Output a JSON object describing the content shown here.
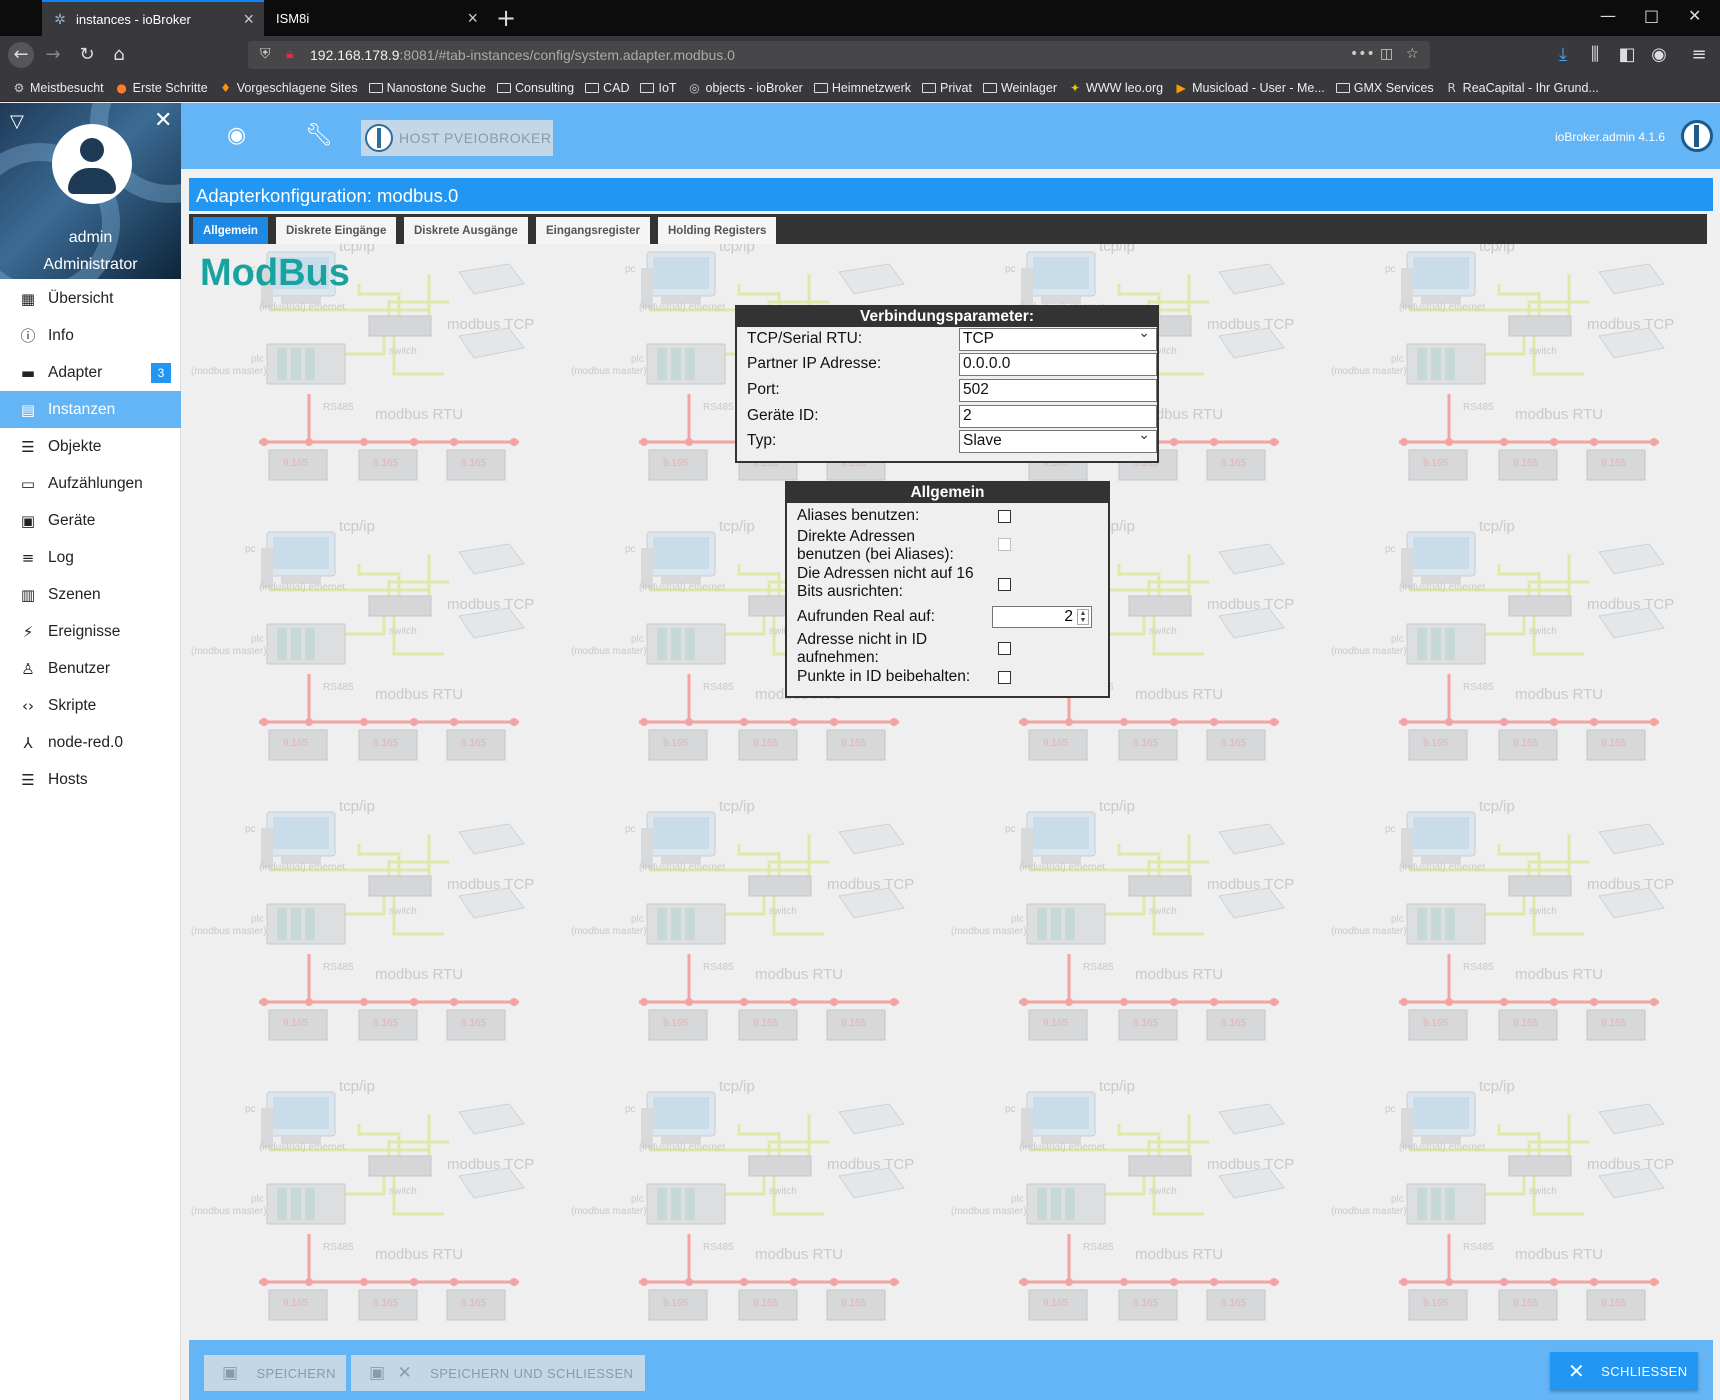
{
  "browser": {
    "tabs": [
      {
        "title": "instances - ioBroker",
        "active": true
      },
      {
        "title": "ISM8i",
        "active": false
      }
    ],
    "url_host": "192.168.178.9",
    "url_rest": ":8081/#tab-instances/config/system.adapter.modbus.0",
    "bookmarks": [
      {
        "label": "Meistbesucht",
        "icon": "gear-icon"
      },
      {
        "label": "Erste Schritte",
        "icon": "firefox-icon"
      },
      {
        "label": "Vorgeschlagene Sites",
        "icon": "bulb-icon"
      },
      {
        "label": "Nanostone Suche",
        "icon": "folder-icon"
      },
      {
        "label": "Consulting",
        "icon": "folder-icon"
      },
      {
        "label": "CAD",
        "icon": "folder-icon"
      },
      {
        "label": "IoT",
        "icon": "folder-icon"
      },
      {
        "label": "objects - ioBroker",
        "icon": "globe-icon"
      },
      {
        "label": "Heimnetzwerk",
        "icon": "folder-icon"
      },
      {
        "label": "Privat",
        "icon": "folder-icon"
      },
      {
        "label": "Weinlager",
        "icon": "folder-icon"
      },
      {
        "label": "WWW leo.org",
        "icon": "leo-icon"
      },
      {
        "label": "Musicload - User - Me...",
        "icon": "play-icon"
      },
      {
        "label": "GMX Services",
        "icon": "folder-icon"
      },
      {
        "label": "ReaCapital - Ihr Grund...",
        "icon": "r-icon"
      }
    ]
  },
  "sidebar": {
    "username": "admin",
    "role": "Administrator",
    "items": [
      {
        "label": "Übersicht",
        "icon": "grid-icon",
        "glyph": "▦"
      },
      {
        "label": "Info",
        "icon": "info-icon",
        "glyph": "ⓘ"
      },
      {
        "label": "Adapter",
        "icon": "store-icon",
        "glyph": "▬",
        "badge": "3"
      },
      {
        "label": "Instanzen",
        "icon": "instances-icon",
        "glyph": "▤",
        "active": true
      },
      {
        "label": "Objekte",
        "icon": "list-icon",
        "glyph": "☰"
      },
      {
        "label": "Aufzählungen",
        "icon": "enum-icon",
        "glyph": "▭"
      },
      {
        "label": "Geräte",
        "icon": "devices-icon",
        "glyph": "▣"
      },
      {
        "label": "Log",
        "icon": "log-icon",
        "glyph": "≡"
      },
      {
        "label": "Szenen",
        "icon": "scenes-icon",
        "glyph": "▥"
      },
      {
        "label": "Ereignisse",
        "icon": "flash-icon",
        "glyph": "⚡"
      },
      {
        "label": "Benutzer",
        "icon": "user-icon",
        "glyph": "♙"
      },
      {
        "label": "Skripte",
        "icon": "code-icon",
        "glyph": "‹›"
      },
      {
        "label": "node-red.0",
        "icon": "node-red-icon",
        "glyph": "⅄"
      },
      {
        "label": "Hosts",
        "icon": "hosts-icon",
        "glyph": "☰"
      }
    ]
  },
  "topbar": {
    "host_label": "HOST PVEIOBROKER",
    "version": "ioBroker.admin 4.1.6"
  },
  "config": {
    "title": "Adapterkonfiguration: modbus.0",
    "tabs": [
      "Allgemein",
      "Diskrete Eingänge",
      "Diskrete Ausgänge",
      "Eingangsregister",
      "Holding Registers"
    ],
    "logo": "ModBus",
    "bg_labels": {
      "tcpip": "tcp/ip",
      "pc": "pc",
      "ethernet": "(industrial) ethernet",
      "modbus_tcp": "modbus TCP",
      "switch": "switch",
      "plc": "plc",
      "modbus_master": "(modbus master)",
      "rs485": "RS485",
      "modbus_rtu": "modbus RTU",
      "display": "9.165"
    },
    "connection": {
      "header": "Verbindungsparameter:",
      "type_label": "TCP/Serial RTU:",
      "type_value": "TCP",
      "ip_label": "Partner IP Adresse:",
      "ip_value": "0.0.0.0",
      "port_label": "Port:",
      "port_value": "502",
      "device_label": "Geräte ID:",
      "device_value": "2",
      "role_label": "Typ:",
      "role_value": "Slave"
    },
    "general": {
      "header": "Allgemein",
      "aliases_label": "Aliases benutzen:",
      "direct_label_1": "Direkte Adressen",
      "direct_label_2": "benutzen (bei Aliases):",
      "align_label_1": "Die Adressen nicht auf 16",
      "align_label_2": "Bits ausrichten:",
      "round_label": "Aufrunden Real auf:",
      "round_value": "2",
      "noaddr_label_1": "Adresse nicht in ID",
      "noaddr_label_2": "aufnehmen:",
      "points_label": "Punkte in ID beibehalten:"
    }
  },
  "bottom": {
    "save": "SPEICHERN",
    "save_close": "SPEICHERN UND SCHLIESSEN",
    "close": "SCHLIESSEN"
  }
}
